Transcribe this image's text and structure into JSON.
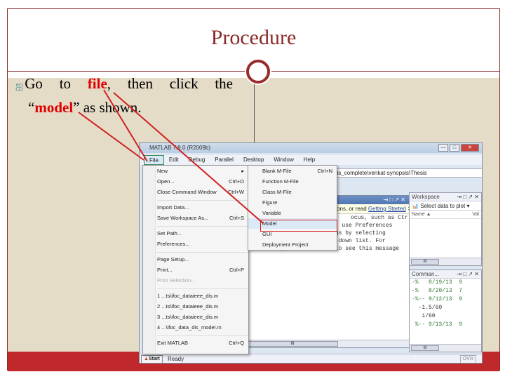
{
  "slide": {
    "title": "Procedure",
    "bullet_prefix": "Go to ",
    "bullet_file": "file",
    "bullet_mid": ", then click the",
    "bullet_open_quote": "“",
    "bullet_model": "model",
    "bullet_end": "” as shown.",
    "accent_color": "#8b2a2a",
    "bottom_bar_color": "#c0292b"
  },
  "matlab": {
    "window_title": "MATLAB 7.9.0 (R2009b)",
    "window_controls": [
      "minimize",
      "maximize",
      "close"
    ],
    "menubar": [
      "File",
      "Edit",
      "Debug",
      "Parallel",
      "Desktop",
      "Window",
      "Help"
    ],
    "current_folder": "\\synopsis_complete\\venkat-synopsis\\Thesis",
    "file_menu": [
      {
        "label": "New",
        "shortcut": "",
        "submenu": true
      },
      {
        "label": "Open...",
        "shortcut": "Ctrl+O"
      },
      {
        "label": "Close Command Window",
        "shortcut": "Ctrl+W"
      },
      {
        "sep": true
      },
      {
        "label": "Import Data...",
        "shortcut": ""
      },
      {
        "label": "Save Workspace As...",
        "shortcut": "Ctrl+S"
      },
      {
        "sep": true
      },
      {
        "label": "Set Path...",
        "shortcut": ""
      },
      {
        "label": "Preferences...",
        "shortcut": ""
      },
      {
        "sep": true
      },
      {
        "label": "Page Setup...",
        "shortcut": ""
      },
      {
        "label": "Print...",
        "shortcut": "Ctrl+P"
      },
      {
        "label": "Print Selection...",
        "shortcut": "",
        "disabled": true
      },
      {
        "sep": true
      },
      {
        "label": "1 ...ts\\ifoc_dataieee_dis.m",
        "shortcut": ""
      },
      {
        "label": "2 ...ts\\ifoc_dataieee_dis.m",
        "shortcut": ""
      },
      {
        "label": "3 ...ts\\ifoc_dataieee_dis.m",
        "shortcut": ""
      },
      {
        "label": "4 ...\\ifoc_data_dis_model.m",
        "shortcut": ""
      },
      {
        "sep": true
      },
      {
        "label": "Exit MATLAB",
        "shortcut": "Ctrl+Q"
      }
    ],
    "new_submenu": [
      {
        "label": "Blank M-File",
        "shortcut": "Ctrl+N"
      },
      {
        "label": "Function M-File",
        "shortcut": ""
      },
      {
        "label": "Class M-File",
        "shortcut": ""
      },
      {
        "label": "Figure",
        "shortcut": ""
      },
      {
        "label": "Variable",
        "shortcut": ""
      },
      {
        "label": "Model",
        "shortcut": "",
        "highlighted": true
      },
      {
        "label": "GUI",
        "shortcut": ""
      },
      {
        "label": "Deployment Project",
        "shortcut": ""
      }
    ],
    "command_window": {
      "tip_text": "ons, or read ",
      "tip_link": "Getting Started",
      "lines": [
        "ocus, such as Ctrl",
        "",
        "",
        "stomize keyboard shortcuts, use Preferences",
        "re previous default settings by selecting",
        "the \"Active settings\" drop-down list. For",
        "",
        ". here if you do not want to see this message"
      ]
    },
    "workspace": {
      "title": "Workspace",
      "toolbar": "Select data to plot",
      "col_name": "Name ▲",
      "col_value": "Val"
    },
    "history": {
      "title": "Comman...",
      "lines": [
        "-%   8/19/13  9",
        "-%   8/20/13  7",
        "-%-- 9/12/13  9",
        "  -1.5/60",
        "   1/60",
        " %-- 9/13/13  9"
      ]
    },
    "status": {
      "start": "Start",
      "text": "Ready",
      "ovr": "OVR"
    }
  }
}
